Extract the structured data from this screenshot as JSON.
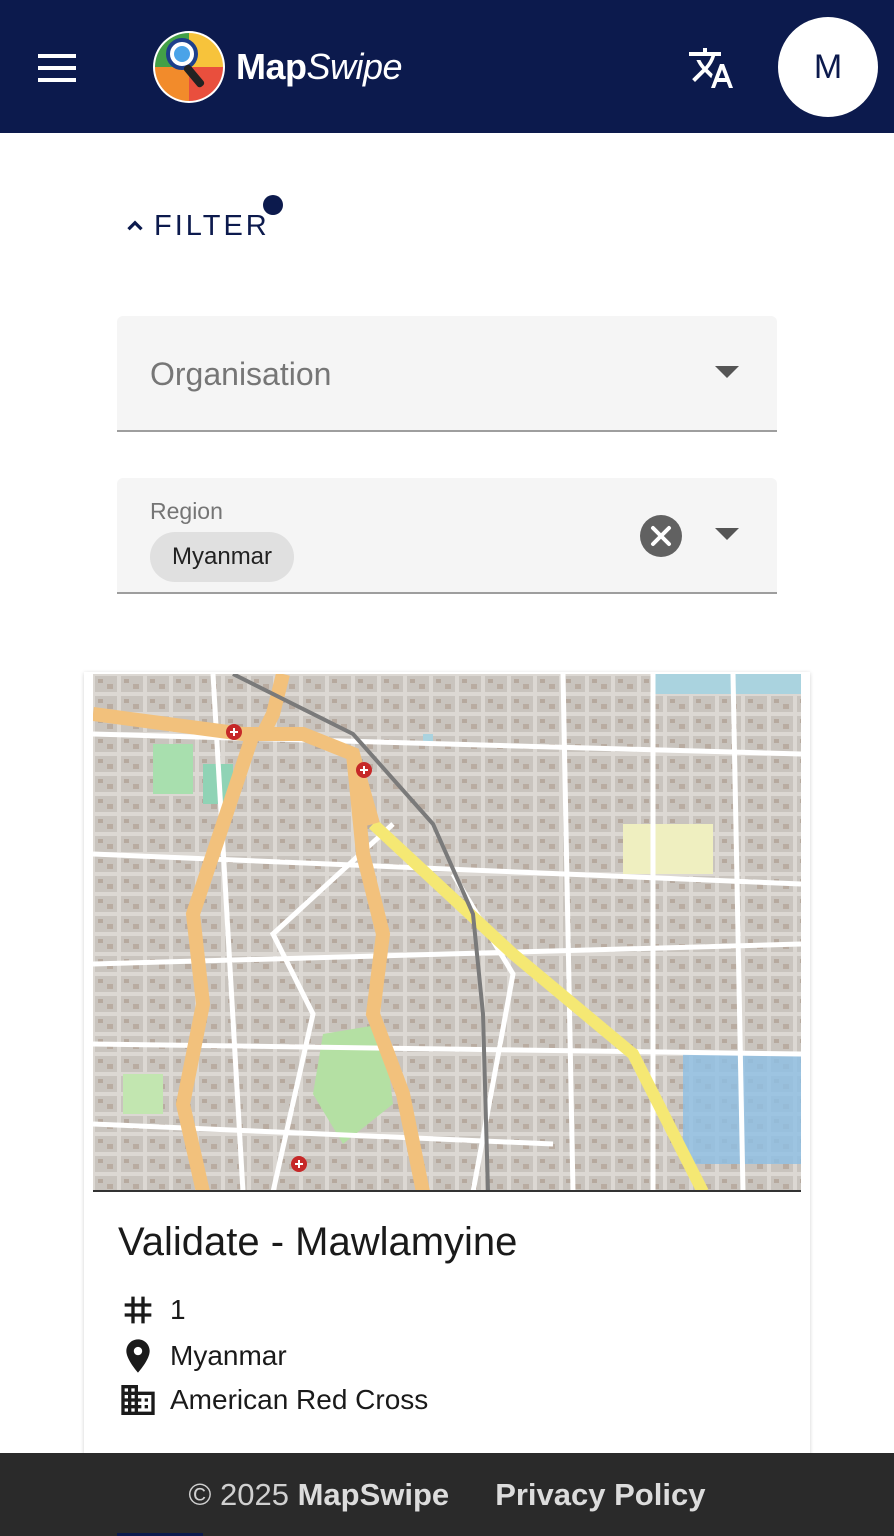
{
  "header": {
    "brand_bold": "Map",
    "brand_italic": "Swipe",
    "avatar_initial": "M",
    "menu_icon": "hamburger-menu-icon",
    "translate_icon": "translate-icon",
    "background_color": "#0c1a4d"
  },
  "filter": {
    "label": "FILTER",
    "organisation_placeholder": "Organisation",
    "region_label": "Region",
    "region_selected": "Myanmar"
  },
  "project_card": {
    "title": "Validate - Mawlamyine",
    "number": "1",
    "region": "Myanmar",
    "organisation": "American Red Cross"
  },
  "footer": {
    "copyright": "© 2025",
    "brand": "MapSwipe",
    "privacy": "Privacy Policy"
  }
}
